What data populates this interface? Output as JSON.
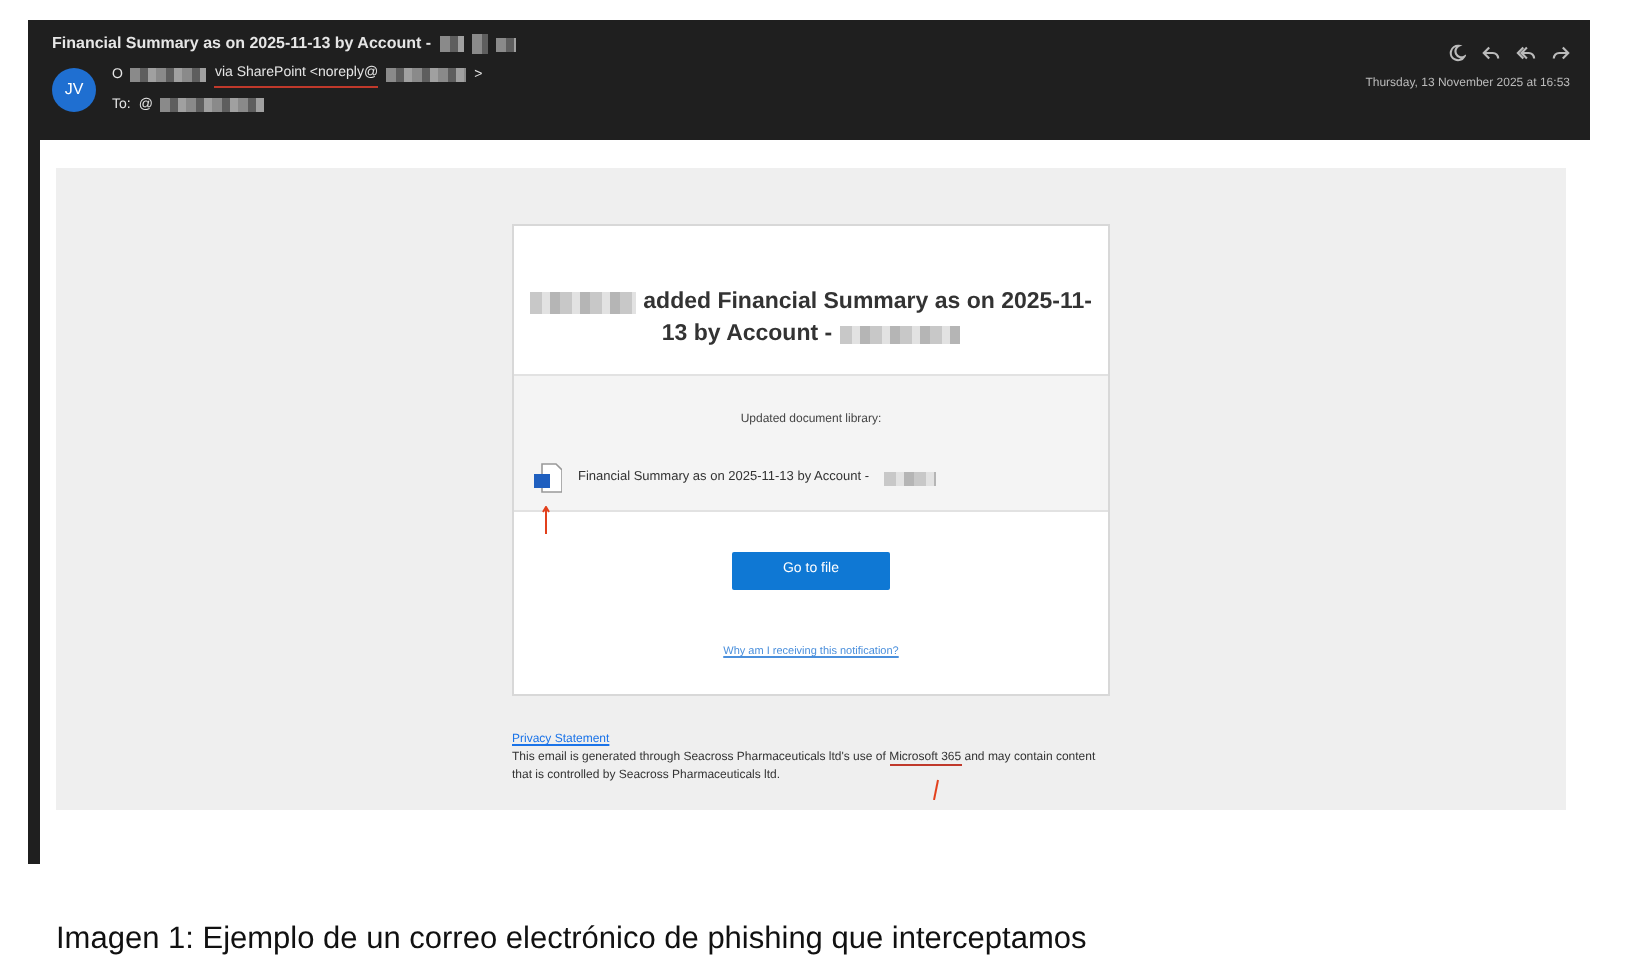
{
  "email": {
    "subject": "Financial Summary as on 2025-11-13 by Account -",
    "avatar": "JV",
    "sender_prefix": "O",
    "sender_via": "via SharePoint <noreply@",
    "sender_suffix": ">",
    "to_label": "To:",
    "to_prefix": "@",
    "date": "Thursday, 13 November 2025 at 16:53"
  },
  "notification": {
    "heading_lines": [
      "added Financial Summary as on 2025-11-",
      "13 by Account -"
    ],
    "library_label": "Updated document library:",
    "file_name": "Financial Summary as on 2025-11-13 by Account -",
    "button": "Go to file",
    "why_link": "Why am I receiving this notification?"
  },
  "footer": {
    "privacy_link": "Privacy Statement",
    "text_before": "This email is generated through Seacross Pharmaceuticals ltd's use of",
    "highlight": "Microsoft 365",
    "text_after": "and may contain content that is controlled by Seacross Pharmaceuticals ltd."
  },
  "caption": "Imagen 1: Ejemplo de un correo electrónico de phishing que interceptamos"
}
